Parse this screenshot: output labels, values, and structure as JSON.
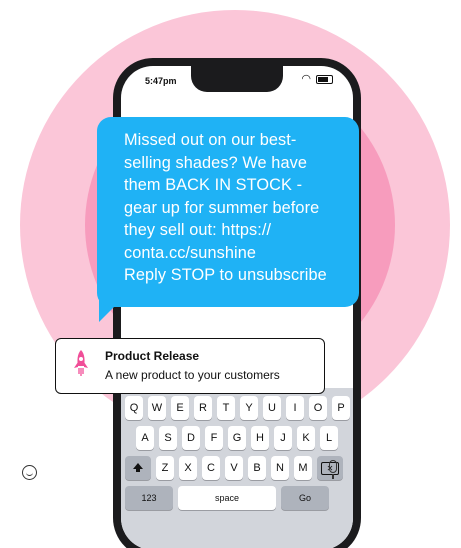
{
  "status_bar": {
    "time": "5:47pm",
    "wifi_icon": "wifi-icon",
    "battery_icon": "battery-icon"
  },
  "message": {
    "lines": [
      "Missed out on our best-",
      "selling shades? We have",
      "them BACK IN STOCK -",
      "gear up for summer before",
      "they sell out: https://",
      "conta.cc/sunshine",
      "Reply STOP to unsubscribe"
    ],
    "bubble_color": "#1fb2f5"
  },
  "notification": {
    "icon": "rocket-icon",
    "title": "Product Release",
    "subtitle": "A new product to your customers"
  },
  "keyboard": {
    "row1": [
      "Q",
      "W",
      "E",
      "R",
      "T",
      "Y",
      "U",
      "I",
      "O",
      "P"
    ],
    "row2": [
      "A",
      "S",
      "D",
      "F",
      "G",
      "H",
      "J",
      "K",
      "L"
    ],
    "row3": [
      "Z",
      "X",
      "C",
      "V",
      "B",
      "N",
      "M"
    ],
    "numbers_label": "123",
    "space_label": "space",
    "go_label": "Go",
    "emoji_icon": "emoji-icon",
    "mic_icon": "microphone-icon"
  },
  "background_colors": [
    "#fbc6d8",
    "#f79cbd",
    "#f36c9f"
  ]
}
